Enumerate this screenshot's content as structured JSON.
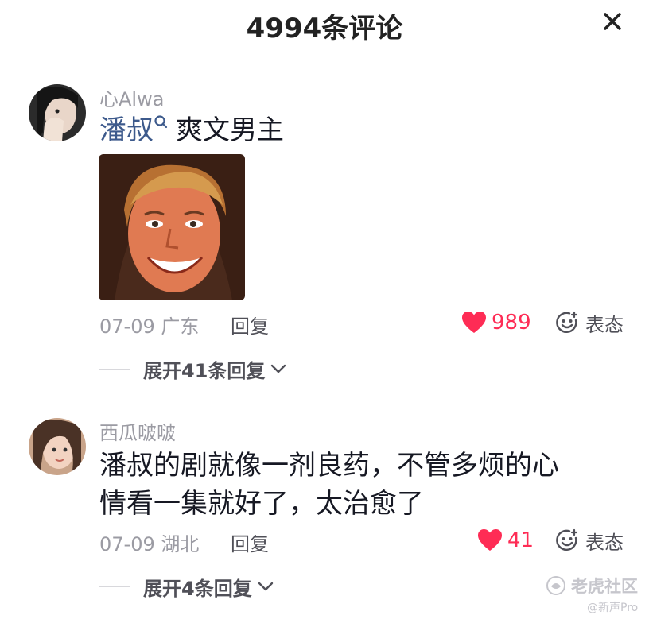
{
  "header": {
    "title": "4994条评论"
  },
  "comments": [
    {
      "username": "心Alwa",
      "mention": "潘叔",
      "text": "爽文男主",
      "date_location": "07-09 广东",
      "reply_label": "回复",
      "like_count": "989",
      "react_label": "表态",
      "expand_label": "展开41条回复"
    },
    {
      "username": "西瓜啵啵",
      "text_line1": "潘叔的剧就像一剂良药，不管多烦的心",
      "text_line2": "情看一集就好了，太治愈了",
      "date_location": "07-09 湖北",
      "reply_label": "回复",
      "like_count": "41",
      "react_label": "表态",
      "expand_label": "展开4条回复"
    }
  ],
  "watermark": {
    "logo_text": "老虎社区",
    "sub_text": "@新声Pro"
  },
  "colors": {
    "like": "#fe2c55",
    "mention": "#3d5a8c",
    "muted": "#9b9ba3"
  },
  "icons": [
    "close-icon",
    "search-icon",
    "heart-icon",
    "emoji-icon",
    "chevron-down-icon"
  ]
}
